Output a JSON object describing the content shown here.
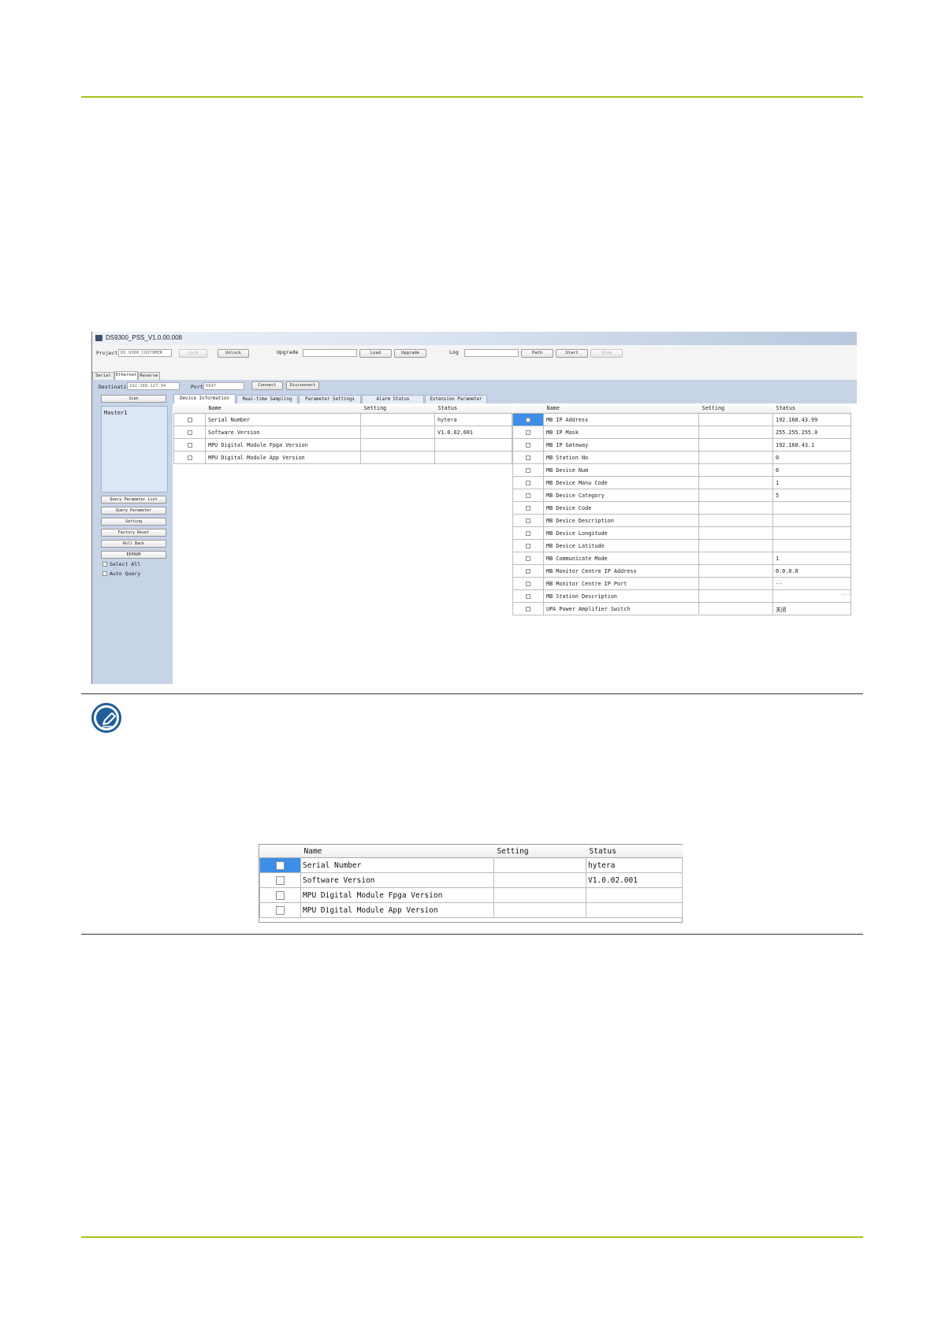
{
  "app": {
    "title": "DS9300_PSS_V1.0.00.008",
    "toolbar": {
      "project_label": "Project",
      "project_value": "DS_9300_CUSTOMER",
      "lock": "Lock",
      "unlock": "Unlock",
      "upgrade_label": "Upgrade",
      "load": "Load",
      "upgrade": "Upgrade",
      "log_label": "Log",
      "path": "Path",
      "start": "Start",
      "stop": "Stop"
    },
    "conn_tabs": [
      "Serial",
      "Ethernet",
      "Reserve"
    ],
    "destination_label": "Destination",
    "destination_value": "192.168.127.94",
    "port_label": "Port",
    "port_value": "6047",
    "connect": "Connect",
    "disconnect": "Disconnect",
    "left": {
      "scan": "Scan",
      "devices": [
        "Master1"
      ],
      "buttons": [
        "Query Parameter List",
        "Query Parameter",
        "Setting",
        "Factory Reset",
        "Roll Back",
        "EEPROM"
      ],
      "select_all": "Select All",
      "auto_query": "Auto Query"
    },
    "tabs": [
      "Device Information",
      "Real-time Sampling",
      "Parameter Settings",
      "Alarm Status",
      "Extension Parameter"
    ],
    "headers": {
      "name": "Name",
      "setting": "Setting",
      "status": "Status"
    },
    "left_rows": [
      {
        "name": "Serial Number",
        "setting": "",
        "status": "hytera"
      },
      {
        "name": "Software Version",
        "setting": "",
        "status": "V1.0.02.001"
      },
      {
        "name": "MPU Digital Module Fpga Version",
        "setting": "",
        "status": ""
      },
      {
        "name": "MPU Digital Module App Version",
        "setting": "",
        "status": ""
      }
    ],
    "right_rows": [
      {
        "name": "MB IP Address",
        "setting": "",
        "status": "192.168.43.99"
      },
      {
        "name": "MB IP Mask",
        "setting": "",
        "status": "255.255.255.0"
      },
      {
        "name": "MB IP Gateway",
        "setting": "",
        "status": "192.168.43.1"
      },
      {
        "name": "MB Station No",
        "setting": "",
        "status": "0"
      },
      {
        "name": "MB Device Num",
        "setting": "",
        "status": "0"
      },
      {
        "name": "MB Device Manu Code",
        "setting": "",
        "status": "1"
      },
      {
        "name": "MB Device Category",
        "setting": "",
        "status": "5"
      },
      {
        "name": "MB Device Code",
        "setting": "",
        "status": ""
      },
      {
        "name": "MB Device Description",
        "setting": "",
        "status": ""
      },
      {
        "name": "MB Device Longitude",
        "setting": "",
        "status": ""
      },
      {
        "name": "MB Device Latitude",
        "setting": "",
        "status": ""
      },
      {
        "name": "MB Communicate Mode",
        "setting": "",
        "status": "1"
      },
      {
        "name": "MB Monitor Centre IP Address",
        "setting": "",
        "status": "0.0.0.0"
      },
      {
        "name": "MB Monitor Centre IP Port",
        "setting": "",
        "status": "--"
      },
      {
        "name": "MB Station Description",
        "setting": "",
        "status": ""
      },
      {
        "name": "UPA Power Amplifier Switch",
        "setting": "",
        "status": "关闭"
      }
    ],
    "ellipsis": "..."
  },
  "zoom_table": {
    "headers": {
      "name": "Name",
      "setting": "Setting",
      "status": "Status"
    },
    "rows": [
      {
        "name": "Serial Number",
        "setting": "",
        "status": "hytera"
      },
      {
        "name": "Software Version",
        "setting": "",
        "status": "V1.0.02.001"
      },
      {
        "name": "MPU Digital Module Fpga Version",
        "setting": "",
        "status": ""
      },
      {
        "name": "MPU Digital Module App Version",
        "setting": "",
        "status": ""
      }
    ]
  },
  "colors": {
    "rule_accent": "#a9c21a",
    "selection": "#3d8ee8",
    "panel": "#c7d3e6",
    "note_icon": "#1f5e9a"
  },
  "icons": [
    "app-icon",
    "note-pencil-icon",
    "checkbox-icon"
  ]
}
